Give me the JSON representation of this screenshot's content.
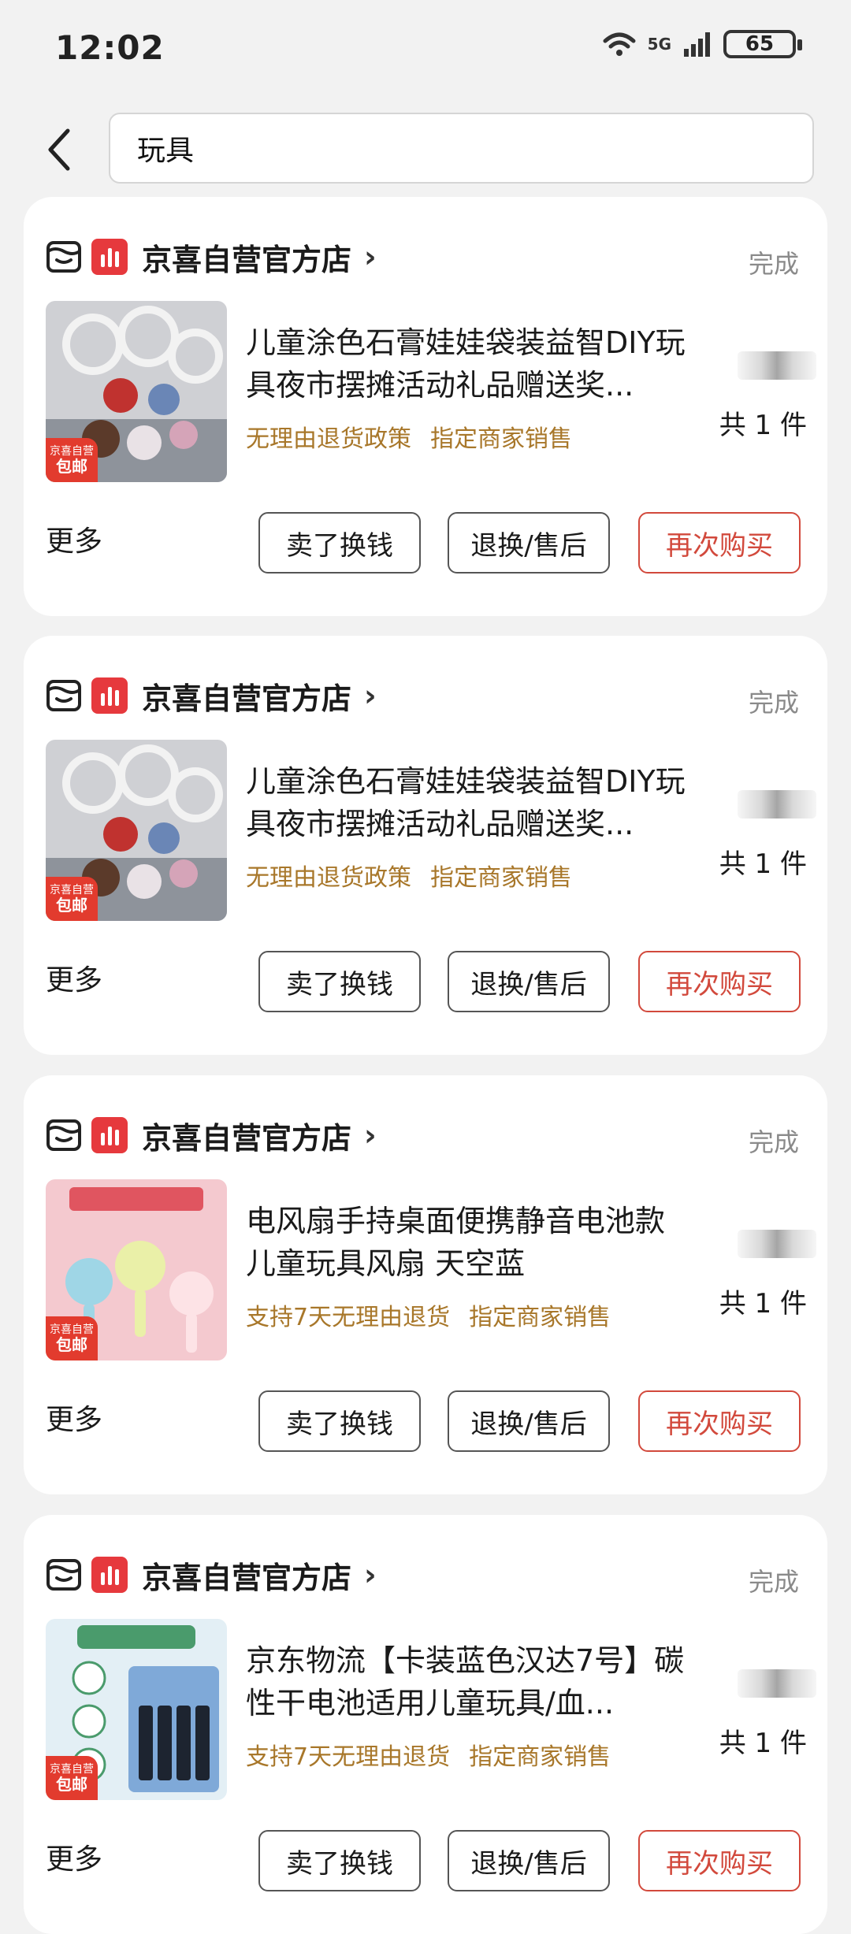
{
  "status_bar": {
    "time": "12:02",
    "battery": "65",
    "network": "5G"
  },
  "search": {
    "query": "玩具"
  },
  "orders": [
    {
      "store": "京喜自营官方店",
      "status": "完成",
      "title": "儿童涂色石膏娃娃袋装益智DIY玩具夜市摆摊活动礼品赠送奖...",
      "tags": [
        "无理由退货政策",
        "指定商家销售"
      ],
      "qty": "共 1 件",
      "badge_small": "京喜自营",
      "badge_big": "包邮"
    },
    {
      "store": "京喜自营官方店",
      "status": "完成",
      "title": "儿童涂色石膏娃娃袋装益智DIY玩具夜市摆摊活动礼品赠送奖...",
      "tags": [
        "无理由退货政策",
        "指定商家销售"
      ],
      "qty": "共 1 件",
      "badge_small": "京喜自营",
      "badge_big": "包邮"
    },
    {
      "store": "京喜自营官方店",
      "status": "完成",
      "title": "电风扇手持桌面便携静音电池款儿童玩具风扇 天空蓝",
      "tags": [
        "支持7天无理由退货",
        "指定商家销售"
      ],
      "qty": "共 1 件",
      "badge_small": "京喜自营",
      "badge_big": "包邮"
    },
    {
      "store": "京喜自营官方店",
      "status": "完成",
      "title": "京东物流【卡装蓝色汉达7号】碳性干电池适用儿童玩具/血...",
      "tags": [
        "支持7天无理由退货",
        "指定商家销售"
      ],
      "qty": "共 1 件",
      "badge_small": "京喜自营",
      "badge_big": "包邮"
    }
  ],
  "actions": {
    "more": "更多",
    "sell": "卖了换钱",
    "refund": "退换/售后",
    "rebuy": "再次购买"
  },
  "colors": {
    "accent": "#d2493c",
    "tag": "#a8772a",
    "brand": "#e6393d"
  }
}
